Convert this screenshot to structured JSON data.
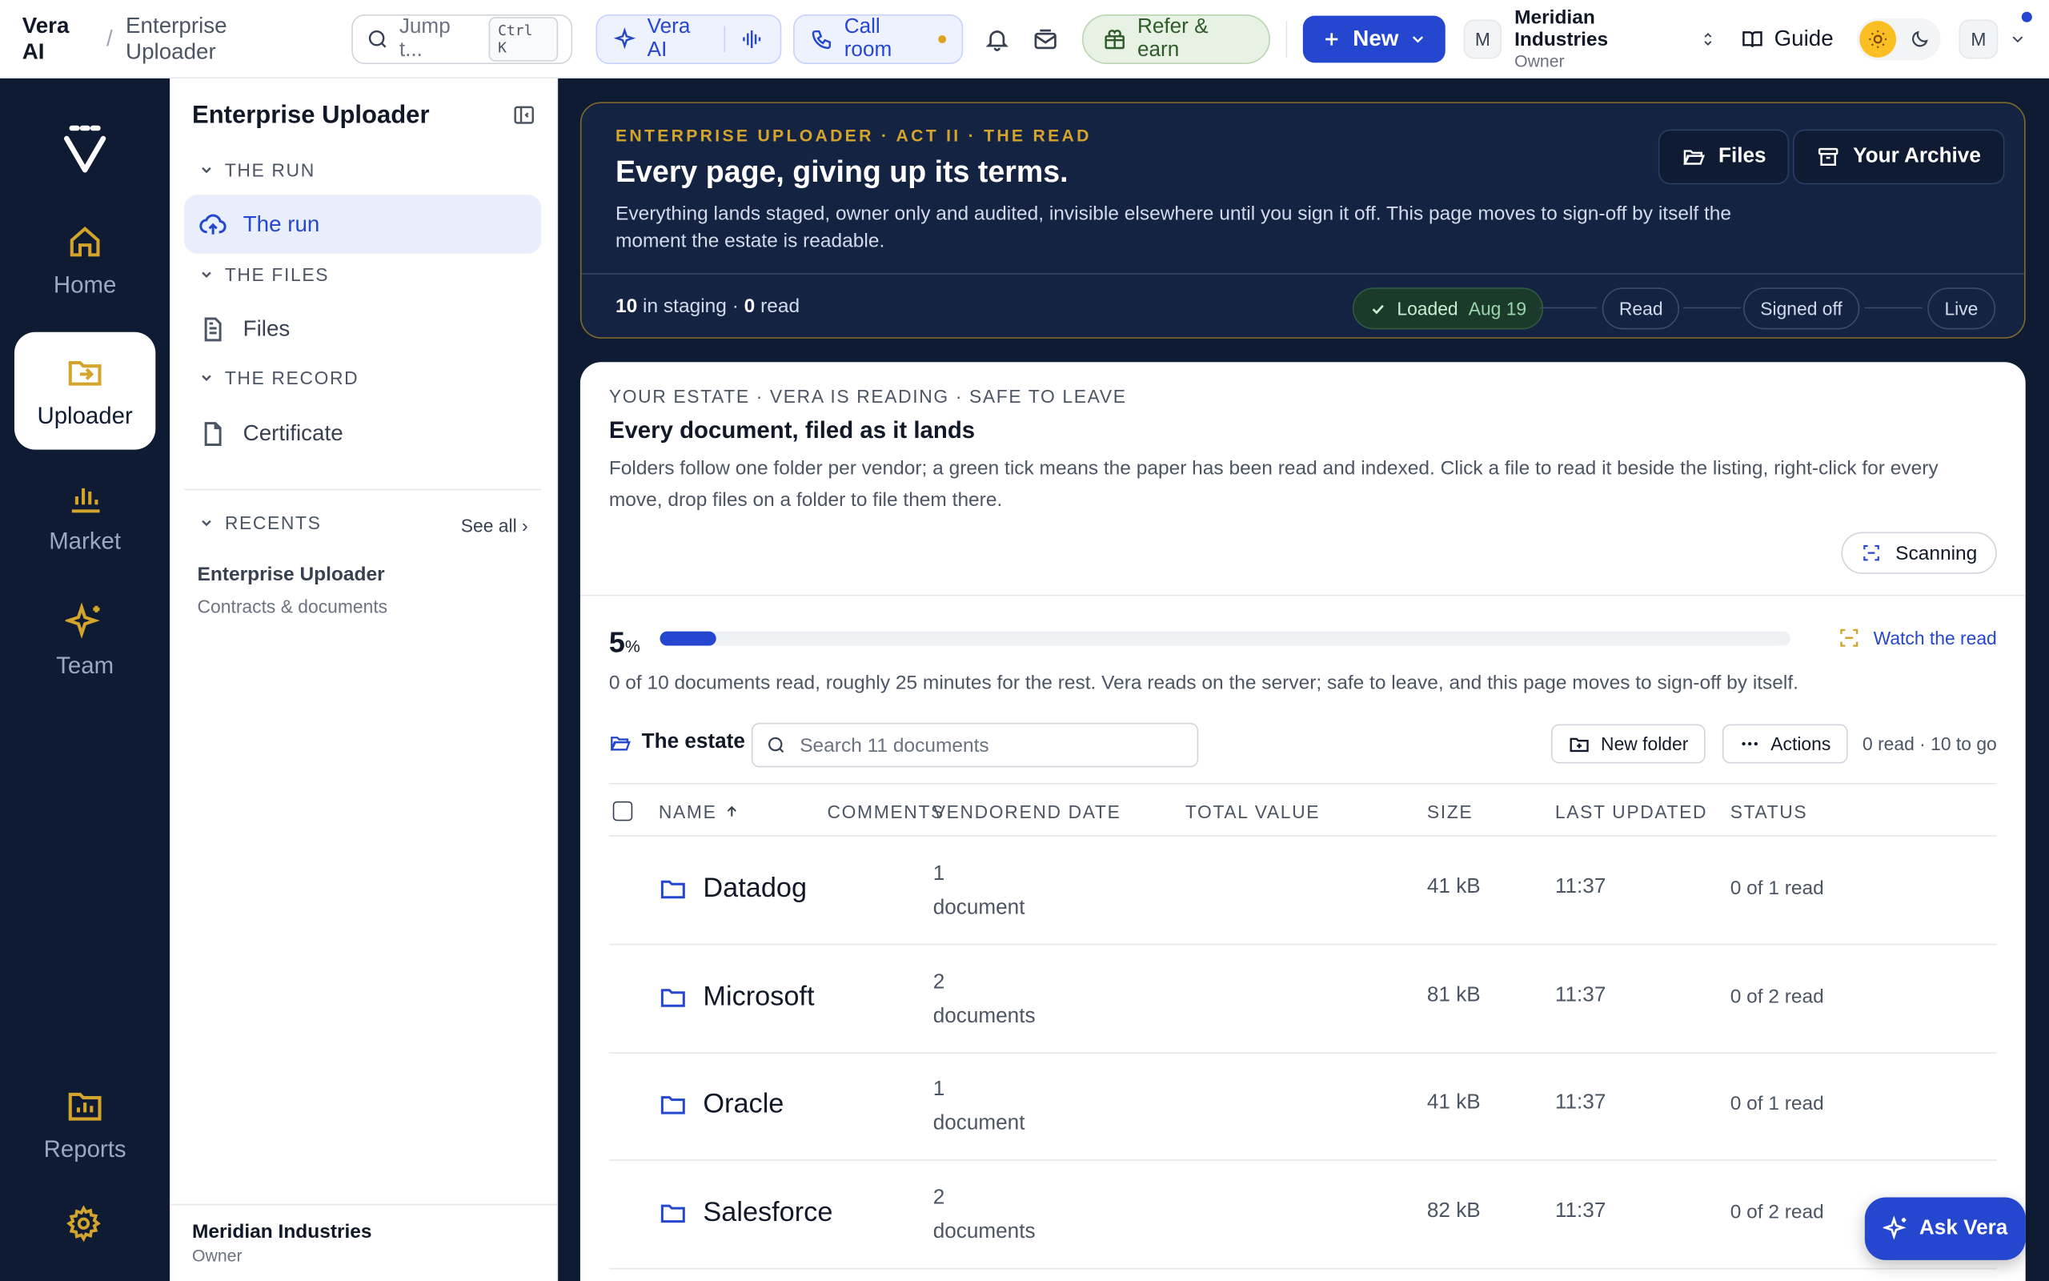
{
  "topbar": {
    "app": "Vera AI",
    "separator": "/",
    "page": "Enterprise Uploader",
    "jump_placeholder": "Jump t...",
    "jump_shortcut": "Ctrl K",
    "vera_label": "Vera AI",
    "call_label": "Call room",
    "refer_label": "Refer & earn",
    "new_label": "New",
    "org_avatar": "M",
    "org_name": "Meridian Industries",
    "org_role": "Owner",
    "guide_label": "Guide",
    "user_avatar": "M"
  },
  "rail": {
    "items": [
      {
        "label": "Home"
      },
      {
        "label": "Uploader"
      },
      {
        "label": "Market"
      },
      {
        "label": "Team"
      },
      {
        "label": "Reports"
      }
    ]
  },
  "sidebar": {
    "title": "Enterprise Uploader",
    "sections": [
      {
        "title": "THE RUN",
        "items": [
          {
            "label": "The run"
          }
        ]
      },
      {
        "title": "THE FILES",
        "items": [
          {
            "label": "Files"
          }
        ]
      },
      {
        "title": "THE RECORD",
        "items": [
          {
            "label": "Certificate"
          }
        ]
      }
    ],
    "recents_title": "RECENTS",
    "see_all": "See all ›",
    "recent": {
      "name": "Enterprise Uploader",
      "sub": "Contracts & documents"
    },
    "footer": {
      "name": "Meridian Industries",
      "role": "Owner"
    }
  },
  "hero": {
    "eyebrow": "ENTERPRISE UPLOADER · ACT II · THE READ",
    "title": "Every page, giving up its terms.",
    "description": "Everything lands staged, owner only and audited, invisible elsewhere until you sign it off. This page moves to sign-off by itself the moment the estate is readable.",
    "files_button": "Files",
    "archive_button": "Your Archive",
    "staging_count": "10",
    "staging_text": " in staging · ",
    "read_count": "0",
    "read_text": " read",
    "stages": [
      {
        "label": "Loaded",
        "date": "Aug 19",
        "done": true
      },
      {
        "label": "Read"
      },
      {
        "label": "Signed off"
      },
      {
        "label": "Live"
      }
    ]
  },
  "estate": {
    "eyebrow": "YOUR ESTATE · VERA IS READING · SAFE TO LEAVE",
    "title": "Every document, filed as it lands",
    "description": "Folders follow one folder per vendor; a green tick means the paper has been read and indexed. Click a file to read it beside the listing, right-click for every move, drop files on a folder to file them there.",
    "scanning_label": "Scanning",
    "progress_value": "5",
    "progress_unit": "%",
    "progress_fraction": 0.05,
    "watch_label": "Watch the read",
    "read_note": "0 of 10 documents read, roughly 25 minutes for the rest. Vera reads on the server; safe to leave, and this page moves to sign-off by itself.",
    "folder_label": "The estate",
    "search_placeholder": "Search 11 documents",
    "new_folder": "New folder",
    "actions": "Actions",
    "counts": "0 read · 10 to go"
  },
  "table": {
    "headers": {
      "name": "NAME",
      "comments": "COMMENTS",
      "vendor": "VENDOR",
      "end_date": "END DATE",
      "total_value": "TOTAL VALUE",
      "size": "SIZE",
      "last_updated": "LAST UPDATED",
      "status": "STATUS"
    },
    "rows": [
      {
        "name": "Datadog",
        "docs_count": "1",
        "docs_label": "document",
        "size": "41 kB",
        "updated": "11:37",
        "status": "0 of 1 read"
      },
      {
        "name": "Microsoft",
        "docs_count": "2",
        "docs_label": "documents",
        "size": "81 kB",
        "updated": "11:37",
        "status": "0 of 2 read"
      },
      {
        "name": "Oracle",
        "docs_count": "1",
        "docs_label": "document",
        "size": "41 kB",
        "updated": "11:37",
        "status": "0 of 1 read"
      },
      {
        "name": "Salesforce",
        "docs_count": "2",
        "docs_label": "documents",
        "size": "82 kB",
        "updated": "11:37",
        "status": "0 of 2 read"
      }
    ]
  },
  "ask_vera": "Ask Vera",
  "colors": {
    "accent": "#2547d0",
    "navy": "#0f1b33",
    "gold": "#d4a52c"
  }
}
